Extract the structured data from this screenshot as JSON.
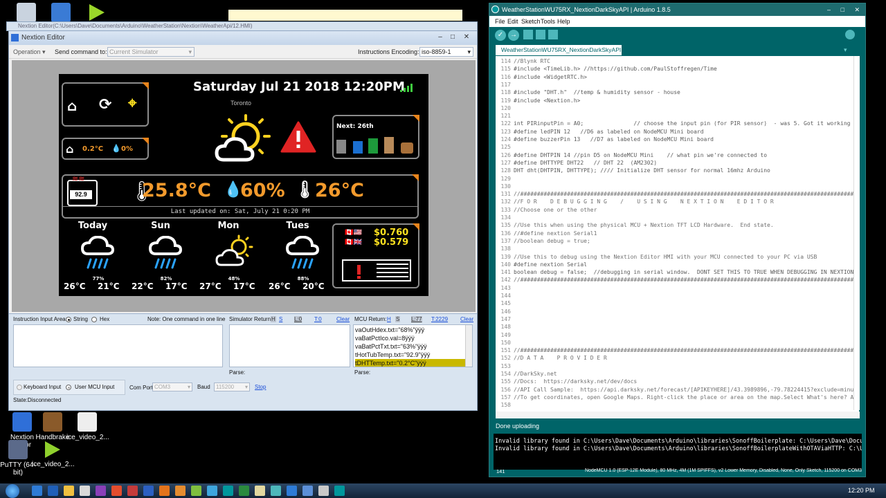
{
  "desktop": {
    "icons": [
      {
        "label": "Nextion Editor",
        "color": "#2f6fd8"
      },
      {
        "label": "Handbrake",
        "color": "#8a5a2a"
      },
      {
        "label": "ice_video_2...",
        "color": "#f1f1f1"
      },
      {
        "label": "PuTTY (64-bit)",
        "color": "#5b6a8a"
      },
      {
        "label": "ice_video_2...",
        "color": "#8fd02d"
      }
    ],
    "background_tab": "Nextion Editor(C:\\Users\\Dave\\Documents\\Arduino\\WeatherStation\\Nextion\\WeatherApi/12.HMI)"
  },
  "nextion": {
    "title": "Nextion Editor",
    "operation_label": "Operation",
    "send_label": "Send command to:",
    "send_value": "Current Simulator",
    "encoding_label": "Instructions Encoding:",
    "encoding_value": "iso-8859-1",
    "screen": {
      "datetime": "Saturday Jul 21 2018 12:20PM",
      "city": "Toronto",
      "next_label": "Next: 26th",
      "hottub_temp": "92.9",
      "indoor_temp": "0.2°C",
      "indoor_pct": "0%",
      "big_temp": "25.8°C",
      "big_humidity": "60%",
      "big_feels": "26°C",
      "last_updated": "Last updated on: Sat, July 21 0:20 PM",
      "forecast": [
        {
          "day": "Today",
          "pop": "77%",
          "hi": "26°C",
          "lo": "21°C",
          "icon": "rain"
        },
        {
          "day": "Sun",
          "pop": "82%",
          "hi": "22°C",
          "lo": "17°C",
          "icon": "rain"
        },
        {
          "day": "Mon",
          "pop": "48%",
          "hi": "27°C",
          "lo": "17°C",
          "icon": "partly-sunny"
        },
        {
          "day": "Tues",
          "pop": "88%",
          "hi": "26°C",
          "lo": "20°C",
          "icon": "rain"
        }
      ],
      "fx_usd": "$0.760",
      "fx_gbp": "$0.579"
    },
    "instr_label": "Instruction Input Area:",
    "opt_string": "String",
    "opt_hex": "Hex",
    "note": "Note: One command in one line",
    "sim_return": "Simulator Return:",
    "sim_h": "H",
    "sim_s": "S",
    "sim_l": "L:0",
    "sim_t": "T:0",
    "sim_clear": "Clear",
    "mcu_return": "MCU Return:",
    "mcu_h": "H",
    "mcu_s": "S",
    "mcu_l": "L:77",
    "mcu_t": "T:2229",
    "mcu_clear": "Clear",
    "mcu_lines": [
      "vaOutHdex.txt=\"68%\"ÿÿÿ",
      "vaBatPctIco.val=8ÿÿÿ",
      "vaBatPctTxt.txt=\"63%\"ÿÿÿ",
      "tHotTubTemp.txt=\"92.9\"ÿÿÿ",
      "tDHTTemp.txt=\"0.2°C\"ÿÿÿ"
    ],
    "parse": "Parse:",
    "keyboard_input": "Keyboard Input",
    "user_mcu_input": "User MCU Input",
    "com_port_label": "Com Port",
    "com_port_value": "COM3",
    "baud_label": "Baud",
    "baud_value": "115200",
    "stop": "Stop",
    "state": "State:Disconnected"
  },
  "arduino": {
    "title": "WeatherStationWU75RX_NextionDarkSkyAPI | Arduino 1.8.5",
    "menus": [
      "File",
      "Edit",
      "Sketch",
      "Tools",
      "Help"
    ],
    "tab": "WeatherStationWU75RX_NextionDarkSkyAPI",
    "lines": [
      [
        "114",
        "//Blynk RTC"
      ],
      [
        "115",
        "#include <TimeLib.h> //https://github.com/PaulStoffregen/Time"
      ],
      [
        "116",
        "#include <WidgetRTC.h>"
      ],
      [
        "117",
        ""
      ],
      [
        "118",
        "#include \"DHT.h\"  //temp & humidity sensor - house"
      ],
      [
        "119",
        "#include <Nextion.h>"
      ],
      [
        "120",
        ""
      ],
      [
        "121",
        ""
      ],
      [
        "122",
        "int PIRinputPin = A0;               // choose the input pin (for PIR sensor)  - was 5. Got it working on a"
      ],
      [
        "123",
        "#define ledPIN 12   //D6 as labeled on NodeMCU Mini board"
      ],
      [
        "124",
        "#define buzzerPin 13   //D7 as labeled on NodeMCU Mini board"
      ],
      [
        "125",
        ""
      ],
      [
        "126",
        "#define DHTPIN 14 //pin D5 on NodeMCU Mini    // what pin we're connected to"
      ],
      [
        "127",
        "#define DHTTYPE DHT22   // DHT 22  (AM2302)"
      ],
      [
        "128",
        "DHT dht(DHTPIN, DHTTYPE); //// Initialize DHT sensor for normal 16mhz Arduino"
      ],
      [
        "129",
        ""
      ],
      [
        "130",
        ""
      ],
      [
        "131",
        "//##############################################################################################################"
      ],
      [
        "132",
        "//F O R    D E B U G G I N G    /    U S I N G    N E X T I O N    E D I T O R"
      ],
      [
        "133",
        "//Choose one or the other"
      ],
      [
        "134",
        ""
      ],
      [
        "135",
        "//Use this when using the physical MCU + Nextion TFT LCD Hardware.  End state."
      ],
      [
        "136",
        "//#define nextion Serial1"
      ],
      [
        "137",
        "//boolean debug = true;"
      ],
      [
        "138",
        ""
      ],
      [
        "139",
        "//Use this to debug using the Nextion Editor HMI with your MCU connected to your PC via USB"
      ],
      [
        "140",
        "#define nextion Serial"
      ],
      [
        "141",
        "boolean debug = false;  //debugging in serial window.  DONT SET THIS TO TRUE WHEN DEBUGGING IN NEXTION HMI"
      ],
      [
        "142",
        "//##############################################################################################################"
      ],
      [
        "143",
        ""
      ],
      [
        "144",
        ""
      ],
      [
        "145",
        ""
      ],
      [
        "146",
        ""
      ],
      [
        "147",
        ""
      ],
      [
        "148",
        ""
      ],
      [
        "149",
        ""
      ],
      [
        "150",
        ""
      ],
      [
        "151",
        "//##############################################################################################################"
      ],
      [
        "152",
        "//D A T A    P R O V I D E R"
      ],
      [
        "153",
        ""
      ],
      [
        "154",
        "//DarkSky.net"
      ],
      [
        "155",
        "//Docs:  https://darksky.net/dev/docs"
      ],
      [
        "156",
        "//API Call Sample:  https://api.darksky.net/forecast/[APIKEYHERE]/43.3989896,-79.78224415?exclude=minutely"
      ],
      [
        "157",
        "//To get coordinates, open Google Maps. Right-click the place or area on the map.Select What's here? At th"
      ],
      [
        "158",
        ""
      ]
    ],
    "status": "Done uploading",
    "console": [
      "Invalid library found in C:\\Users\\Dave\\Documents\\Arduino\\libraries\\SonoffBoilerplate: C:\\Users\\Dave\\Documents\\A",
      "Invalid library found in C:\\Users\\Dave\\Documents\\Arduino\\libraries\\SonoffBoilerplateWithOTAViaHTTP: C:\\Users\\Dav"
    ],
    "footer_line": "141",
    "footer_board": "NodeMCU 1.0 (ESP-12E Module), 80 MHz, 4M (1M SPIFFS), v2 Lower Memory, Disabled, None, Only Sketch, 115200 on COM3"
  },
  "taskbar": {
    "clock": "12:20 PM"
  }
}
